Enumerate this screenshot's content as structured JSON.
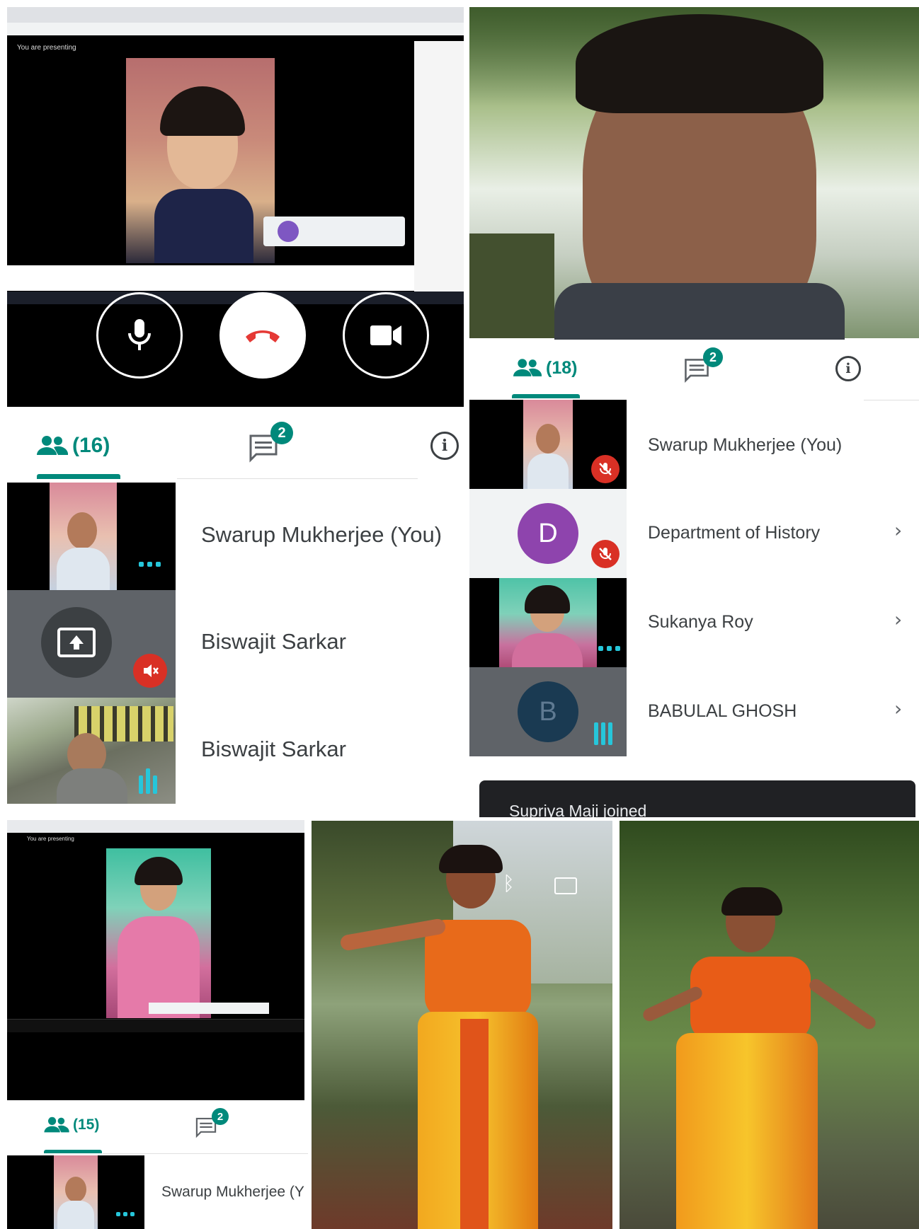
{
  "panels": {
    "top_left": {
      "presenting_label": "You are presenting",
      "controls": {
        "mic": "mic-icon",
        "end_call": "end-call-icon",
        "camera": "video-camera-icon"
      },
      "tabs": {
        "people_count": "(16)",
        "chat_badge": "2"
      },
      "participants": [
        {
          "name": "Swarup Mukherjee (You)"
        },
        {
          "name": "Biswajit Sarkar"
        },
        {
          "name": "Biswajit Sarkar"
        }
      ]
    },
    "top_right": {
      "tabs": {
        "people_count": "(18)",
        "chat_badge": "2"
      },
      "participants": [
        {
          "name": "Swarup Mukherjee (You)"
        },
        {
          "name": "Department of History",
          "avatar_letter": "D",
          "avatar_color": "#8e44ad"
        },
        {
          "name": "Sukanya Roy"
        },
        {
          "name": "BABULAL GHOSH",
          "avatar_letter": "B",
          "avatar_color": "#1a3a52"
        }
      ],
      "toast": "Supriya Maji joined"
    },
    "bottom_left": {
      "presenting_label": "You are presenting",
      "tabs": {
        "people_count": "(15)",
        "chat_badge": "2"
      },
      "participants": [
        {
          "name": "Swarup Mukherjee (Y"
        }
      ]
    }
  },
  "colors": {
    "accent": "#00897b",
    "muted_red": "#d93025",
    "audio_cyan": "#26c6da",
    "dark_tile": "#5f6368"
  }
}
